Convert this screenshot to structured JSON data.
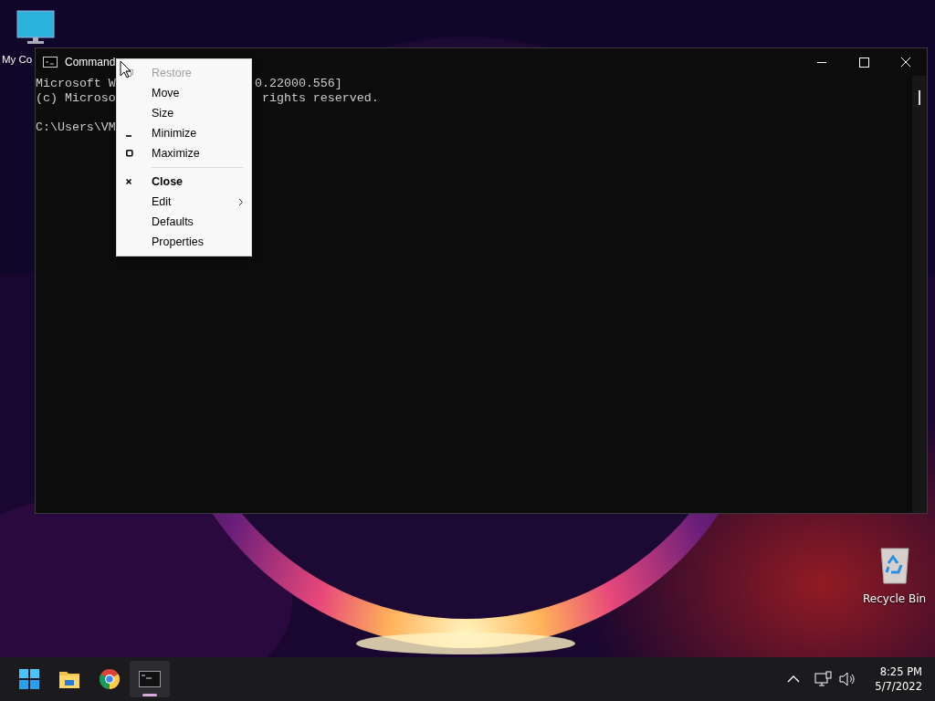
{
  "desktop_icons": [
    {
      "label": "My Co",
      "kind": "computer"
    },
    {
      "label": "Recycle Bin",
      "kind": "recycle"
    }
  ],
  "window": {
    "title": "Command",
    "console_lines": [
      {
        "left": "Microsoft W",
        "right": "0.22000.556]"
      },
      {
        "left": "(c) Microso",
        "right": "rights reserved."
      },
      {
        "left": "C:\\Users\\VM"
      }
    ]
  },
  "context_menu": [
    {
      "label": "Restore",
      "kind": "restore",
      "disabled": true
    },
    {
      "label": "Move",
      "kind": "plain",
      "disabled": false
    },
    {
      "label": "Size",
      "kind": "plain",
      "disabled": false
    },
    {
      "label": "Minimize",
      "kind": "minimize",
      "disabled": false
    },
    {
      "label": "Maximize",
      "kind": "maximize",
      "disabled": false
    },
    {
      "kind": "separator"
    },
    {
      "label": "Close",
      "kind": "close",
      "disabled": false
    },
    {
      "label": "Edit",
      "kind": "submenu",
      "disabled": false
    },
    {
      "label": "Defaults",
      "kind": "plain",
      "disabled": false
    },
    {
      "label": "Properties",
      "kind": "plain",
      "disabled": false
    }
  ],
  "taskbar": {
    "apps": [
      {
        "kind": "start",
        "selected": false
      },
      {
        "kind": "folder",
        "selected": false
      },
      {
        "kind": "browser",
        "selected": false
      },
      {
        "kind": "terminal",
        "selected": true
      }
    ],
    "time": "8:25 PM",
    "date": "5/7/2022"
  }
}
